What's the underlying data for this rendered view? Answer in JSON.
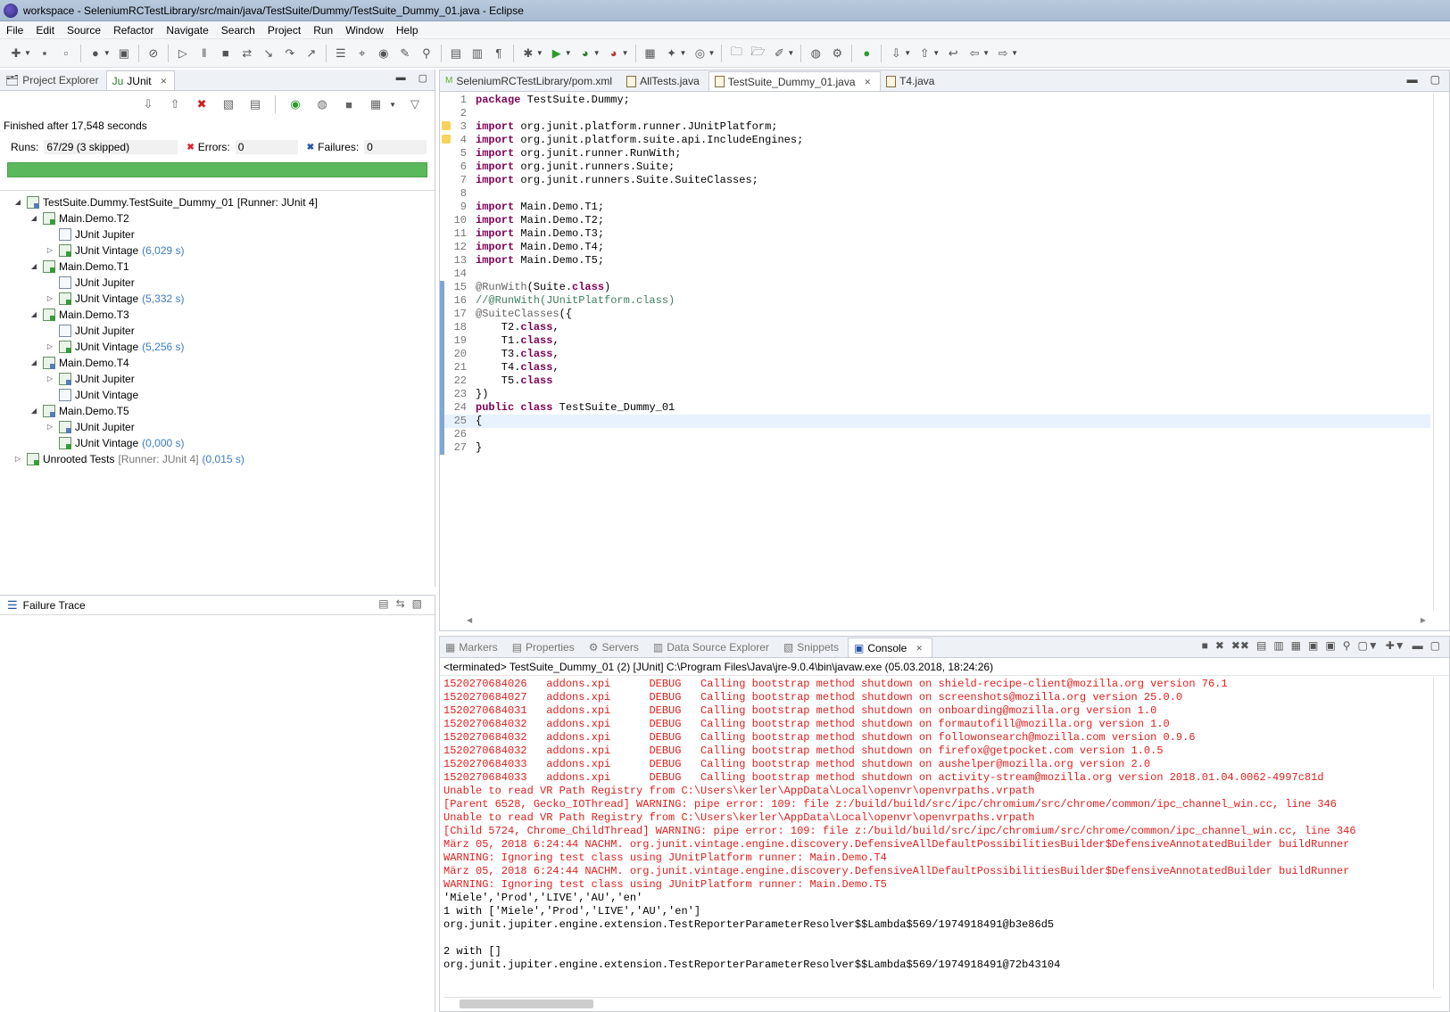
{
  "window": {
    "title": "workspace - SeleniumRCTestLibrary/src/main/java/TestSuite/Dummy/TestSuite_Dummy_01.java - Eclipse"
  },
  "menu": [
    "File",
    "Edit",
    "Source",
    "Refactor",
    "Navigate",
    "Search",
    "Project",
    "Run",
    "Window",
    "Help"
  ],
  "left": {
    "tabs": [
      {
        "label": "Project Explorer"
      },
      {
        "label": "JUnit"
      }
    ],
    "finished": "Finished after 17,548 seconds",
    "runs_label": "Runs:",
    "runs_value": "67/29 (3 skipped)",
    "errors_label": "Errors:",
    "errors_value": "0",
    "failures_label": "Failures:",
    "failures_value": "0",
    "progress": 1.0,
    "tree": [
      {
        "label": "TestSuite.Dummy.TestSuite_Dummy_01",
        "runner": "[Runner: JUnit 4]",
        "time": "",
        "indent": 0,
        "expanded": "open",
        "icon": "skip"
      },
      {
        "label": "Main.Demo.T2",
        "runner": "",
        "time": "",
        "indent": 1,
        "expanded": "open",
        "icon": "pass"
      },
      {
        "label": "JUnit Jupiter",
        "runner": "",
        "time": "",
        "indent": 2,
        "expanded": "none",
        "icon": "leaf"
      },
      {
        "label": "JUnit Vintage",
        "runner": "",
        "time": "(6,029 s)",
        "indent": 2,
        "expanded": "closed",
        "icon": "pass"
      },
      {
        "label": "Main.Demo.T1",
        "runner": "",
        "time": "",
        "indent": 1,
        "expanded": "open",
        "icon": "pass"
      },
      {
        "label": "JUnit Jupiter",
        "runner": "",
        "time": "",
        "indent": 2,
        "expanded": "none",
        "icon": "leaf"
      },
      {
        "label": "JUnit Vintage",
        "runner": "",
        "time": "(5,332 s)",
        "indent": 2,
        "expanded": "closed",
        "icon": "pass"
      },
      {
        "label": "Main.Demo.T3",
        "runner": "",
        "time": "",
        "indent": 1,
        "expanded": "open",
        "icon": "pass"
      },
      {
        "label": "JUnit Jupiter",
        "runner": "",
        "time": "",
        "indent": 2,
        "expanded": "none",
        "icon": "leaf"
      },
      {
        "label": "JUnit Vintage",
        "runner": "",
        "time": "(5,256 s)",
        "indent": 2,
        "expanded": "closed",
        "icon": "pass"
      },
      {
        "label": "Main.Demo.T4",
        "runner": "",
        "time": "",
        "indent": 1,
        "expanded": "open",
        "icon": "skip"
      },
      {
        "label": "JUnit Jupiter",
        "runner": "",
        "time": "",
        "indent": 2,
        "expanded": "closed",
        "icon": "skip"
      },
      {
        "label": "JUnit Vintage",
        "runner": "",
        "time": "",
        "indent": 2,
        "expanded": "none",
        "icon": "leaf"
      },
      {
        "label": "Main.Demo.T5",
        "runner": "",
        "time": "",
        "indent": 1,
        "expanded": "open",
        "icon": "skip"
      },
      {
        "label": "JUnit Jupiter",
        "runner": "",
        "time": "",
        "indent": 2,
        "expanded": "closed",
        "icon": "skip"
      },
      {
        "label": "JUnit Vintage",
        "runner": "",
        "time": "(0,000 s)",
        "indent": 2,
        "expanded": "none",
        "icon": "pass"
      },
      {
        "label": "Unrooted Tests",
        "runner": "[Runner: JUnit 4]",
        "time": "(0,015 s)",
        "indent": 0,
        "expanded": "closed",
        "icon": "pass"
      }
    ],
    "failure_trace": "Failure Trace"
  },
  "editor": {
    "tabs": [
      {
        "label": "SeleniumRCTestLibrary/pom.xml",
        "active": false
      },
      {
        "label": "AllTests.java",
        "active": false
      },
      {
        "label": "TestSuite_Dummy_01.java",
        "active": true
      },
      {
        "label": "T4.java",
        "active": false
      }
    ],
    "lines": [
      {
        "n": "1",
        "html": "<span class=\"kw\">package</span> TestSuite.Dummy;"
      },
      {
        "n": "2",
        "html": ""
      },
      {
        "n": "3",
        "html": "<span class=\"kw\">import</span> org.junit.platform.runner.JUnitPlatform;",
        "warn": true
      },
      {
        "n": "4",
        "html": "<span class=\"kw\">import</span> org.junit.platform.suite.api.IncludeEngines;",
        "warn": true
      },
      {
        "n": "5",
        "html": "<span class=\"kw\">import</span> org.junit.runner.RunWith;"
      },
      {
        "n": "6",
        "html": "<span class=\"kw\">import</span> org.junit.runners.Suite;"
      },
      {
        "n": "7",
        "html": "<span class=\"kw\">import</span> org.junit.runners.Suite.SuiteClasses;"
      },
      {
        "n": "8",
        "html": ""
      },
      {
        "n": "9",
        "html": "<span class=\"kw\">import</span> Main.Demo.T1;"
      },
      {
        "n": "10",
        "html": "<span class=\"kw\">import</span> Main.Demo.T2;"
      },
      {
        "n": "11",
        "html": "<span class=\"kw\">import</span> Main.Demo.T3;"
      },
      {
        "n": "12",
        "html": "<span class=\"kw\">import</span> Main.Demo.T4;"
      },
      {
        "n": "13",
        "html": "<span class=\"kw\">import</span> Main.Demo.T5;"
      },
      {
        "n": "14",
        "html": ""
      },
      {
        "n": "15",
        "html": "<span class=\"an\">@RunWith</span>(Suite.<span class=\"kw\">class</span>)",
        "changed": true
      },
      {
        "n": "16",
        "html": "<span class=\"cm\">//@RunWith(JUnitPlatform.class)</span>",
        "changed": true
      },
      {
        "n": "17",
        "html": "<span class=\"an\">@SuiteClasses</span>({",
        "changed": true
      },
      {
        "n": "18",
        "html": "    T2.<span class=\"kw\">class</span>,",
        "changed": true
      },
      {
        "n": "19",
        "html": "    T1.<span class=\"kw\">class</span>,",
        "changed": true
      },
      {
        "n": "20",
        "html": "    T3.<span class=\"kw\">class</span>,",
        "changed": true
      },
      {
        "n": "21",
        "html": "    T4.<span class=\"kw\">class</span>,",
        "changed": true
      },
      {
        "n": "22",
        "html": "    T5.<span class=\"kw\">class</span>",
        "changed": true
      },
      {
        "n": "23",
        "html": "})",
        "changed": true
      },
      {
        "n": "24",
        "html": "<span class=\"kw\">public</span> <span class=\"kw\">class</span> TestSuite_Dummy_01",
        "changed": true
      },
      {
        "n": "25",
        "html": "{",
        "changed": true,
        "cur": true
      },
      {
        "n": "26",
        "html": "",
        "changed": true
      },
      {
        "n": "27",
        "html": "}",
        "changed": true
      }
    ]
  },
  "console": {
    "tabs": [
      {
        "label": "Markers",
        "active": false
      },
      {
        "label": "Properties",
        "active": false
      },
      {
        "label": "Servers",
        "active": false
      },
      {
        "label": "Data Source Explorer",
        "active": false
      },
      {
        "label": "Snippets",
        "active": false
      },
      {
        "label": "Console",
        "active": true
      }
    ],
    "terminated": "<terminated> TestSuite_Dummy_01 (2) [JUnit] C:\\Program Files\\Java\\jre-9.0.4\\bin\\javaw.exe (05.03.2018, 18:24:26)",
    "lines": [
      {
        "t": "1520270684026   addons.xpi      DEBUG   Calling bootstrap method shutdown on shield-recipe-client@mozilla.org version 76.1",
        "c": "red"
      },
      {
        "t": "1520270684027   addons.xpi      DEBUG   Calling bootstrap method shutdown on screenshots@mozilla.org version 25.0.0",
        "c": "red"
      },
      {
        "t": "1520270684031   addons.xpi      DEBUG   Calling bootstrap method shutdown on onboarding@mozilla.org version 1.0",
        "c": "red"
      },
      {
        "t": "1520270684032   addons.xpi      DEBUG   Calling bootstrap method shutdown on formautofill@mozilla.org version 1.0",
        "c": "red"
      },
      {
        "t": "1520270684032   addons.xpi      DEBUG   Calling bootstrap method shutdown on followonsearch@mozilla.com version 0.9.6",
        "c": "red"
      },
      {
        "t": "1520270684032   addons.xpi      DEBUG   Calling bootstrap method shutdown on firefox@getpocket.com version 1.0.5",
        "c": "red"
      },
      {
        "t": "1520270684033   addons.xpi      DEBUG   Calling bootstrap method shutdown on aushelper@mozilla.org version 2.0",
        "c": "red"
      },
      {
        "t": "1520270684033   addons.xpi      DEBUG   Calling bootstrap method shutdown on activity-stream@mozilla.org version 2018.01.04.0062-4997c81d",
        "c": "red"
      },
      {
        "t": "Unable to read VR Path Registry from C:\\Users\\kerler\\AppData\\Local\\openvr\\openvrpaths.vrpath",
        "c": "red"
      },
      {
        "t": "[Parent 6528, Gecko_IOThread] WARNING: pipe error: 109: file z:/build/build/src/ipc/chromium/src/chrome/common/ipc_channel_win.cc, line 346",
        "c": "red"
      },
      {
        "t": "Unable to read VR Path Registry from C:\\Users\\kerler\\AppData\\Local\\openvr\\openvrpaths.vrpath",
        "c": "red"
      },
      {
        "t": "[Child 5724, Chrome_ChildThread] WARNING: pipe error: 109: file z:/build/build/src/ipc/chromium/src/chrome/common/ipc_channel_win.cc, line 346",
        "c": "red"
      },
      {
        "t": "März 05, 2018 6:24:44 NACHM. org.junit.vintage.engine.discovery.DefensiveAllDefaultPossibilitiesBuilder$DefensiveAnnotatedBuilder buildRunner",
        "c": "red"
      },
      {
        "t": "WARNING: Ignoring test class using JUnitPlatform runner: Main.Demo.T4",
        "c": "red"
      },
      {
        "t": "März 05, 2018 6:24:44 NACHM. org.junit.vintage.engine.discovery.DefensiveAllDefaultPossibilitiesBuilder$DefensiveAnnotatedBuilder buildRunner",
        "c": "red"
      },
      {
        "t": "WARNING: Ignoring test class using JUnitPlatform runner: Main.Demo.T5",
        "c": "red"
      },
      {
        "t": "'Miele','Prod','LIVE','AU','en'",
        "c": "blk"
      },
      {
        "t": "1 with ['Miele','Prod','LIVE','AU','en']",
        "c": "blk"
      },
      {
        "t": "org.junit.jupiter.engine.extension.TestReporterParameterResolver$$Lambda$569/1974918491@b3e86d5",
        "c": "blk"
      },
      {
        "t": "",
        "c": "blk"
      },
      {
        "t": "2 with []",
        "c": "blk"
      },
      {
        "t": "org.junit.jupiter.engine.extension.TestReporterParameterResolver$$Lambda$569/1974918491@72b43104",
        "c": "blk"
      }
    ]
  }
}
